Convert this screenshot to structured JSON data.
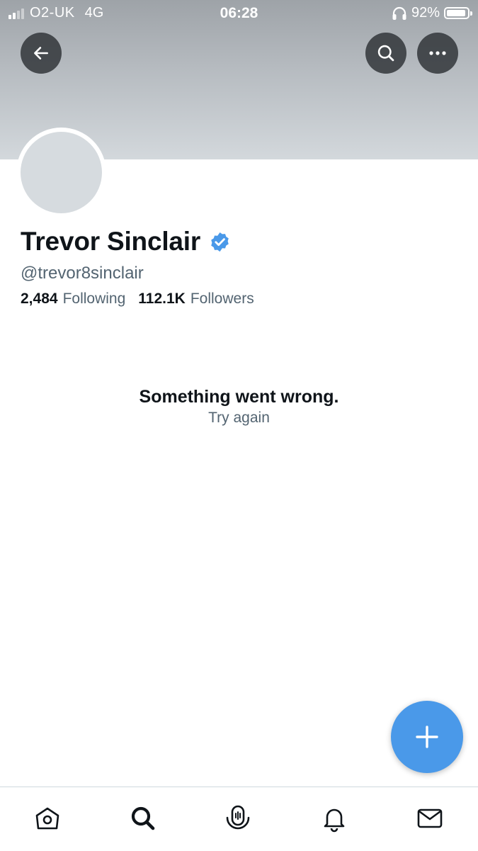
{
  "status_bar": {
    "carrier": "O2-UK",
    "network": "4G",
    "time": "06:28",
    "battery": "92%",
    "battery_level": 0.92
  },
  "header": {
    "back_icon": "arrow-left-icon",
    "search_icon": "search-icon",
    "more_icon": "more-horizontal-icon"
  },
  "profile": {
    "name": "Trevor Sinclair",
    "verified": true,
    "handle": "@trevor8sinclair",
    "following_count": "2,484",
    "following_label": "Following",
    "followers_count": "112.1K",
    "followers_label": "Followers"
  },
  "error": {
    "title": "Something went wrong.",
    "retry": "Try again"
  },
  "fab": {
    "icon": "plus-icon"
  },
  "tabbar": {
    "items": [
      "home-icon",
      "search-icon",
      "spaces-icon",
      "notifications-icon",
      "messages-icon"
    ]
  },
  "colors": {
    "accent": "#4a99e9",
    "text_primary": "#0f1419",
    "text_secondary": "#536471"
  }
}
